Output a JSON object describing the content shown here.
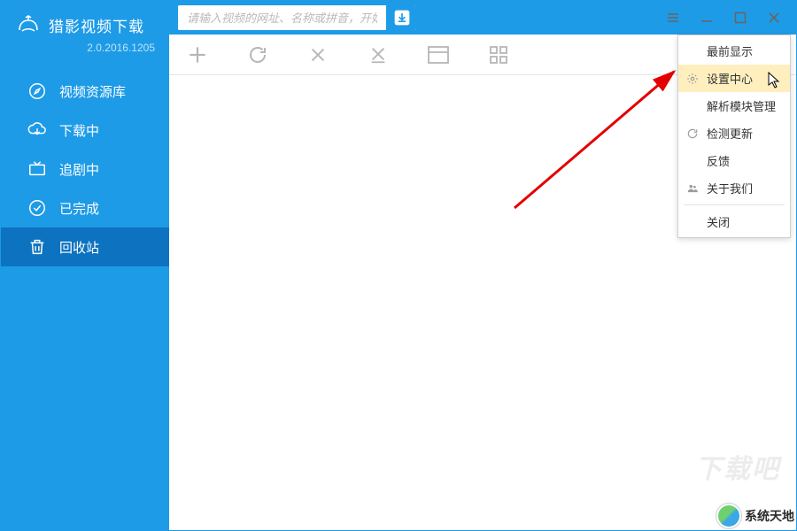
{
  "brand": {
    "title": "猎影视频下载",
    "version": "2.0.2016.1205"
  },
  "search": {
    "placeholder": "请输入视频的网址、名称或拼音，开始下载"
  },
  "nav": {
    "items": [
      {
        "label": "视频资源库"
      },
      {
        "label": "下载中"
      },
      {
        "label": "追剧中"
      },
      {
        "label": "已完成"
      },
      {
        "label": "回收站"
      }
    ]
  },
  "menu": {
    "items": [
      {
        "label": "最前显示"
      },
      {
        "label": "设置中心"
      },
      {
        "label": "解析模块管理"
      },
      {
        "label": "检测更新"
      },
      {
        "label": "反馈"
      },
      {
        "label": "关于我们"
      },
      {
        "label": "关闭"
      }
    ]
  },
  "watermark": "下载吧",
  "footer": "系统天地"
}
